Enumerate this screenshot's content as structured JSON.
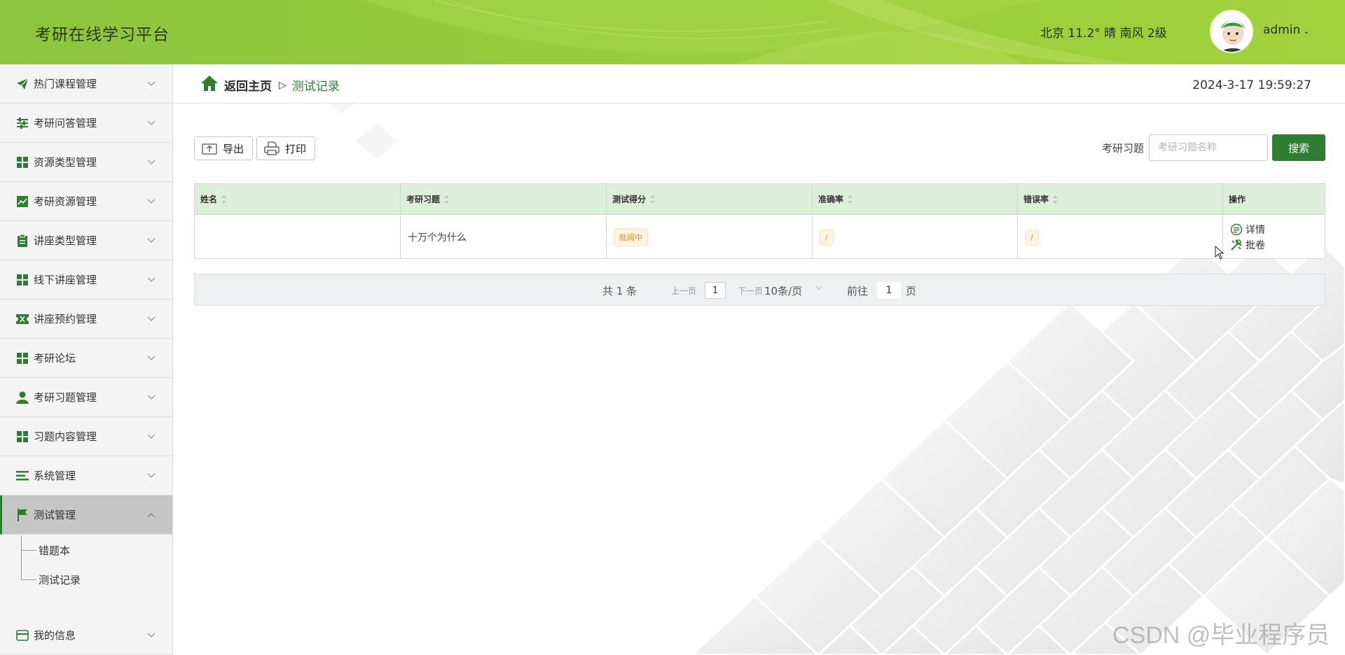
{
  "header": {
    "app_title": "考研在线学习平台",
    "weather": "北京  11.2°  晴  南风  2级",
    "username": "admin",
    "caret": "⌄"
  },
  "sidebar": {
    "items": [
      {
        "label": "热门课程管理",
        "icon": "paper-plane-icon"
      },
      {
        "label": "考研问答管理",
        "icon": "sliders-icon"
      },
      {
        "label": "资源类型管理",
        "icon": "grid-icon"
      },
      {
        "label": "考研资源管理",
        "icon": "chart-line-icon"
      },
      {
        "label": "讲座类型管理",
        "icon": "clipboard-icon"
      },
      {
        "label": "线下讲座管理",
        "icon": "grid-icon"
      },
      {
        "label": "讲座预约管理",
        "icon": "ticket-icon"
      },
      {
        "label": "考研论坛",
        "icon": "grid-icon"
      },
      {
        "label": "考研习题管理",
        "icon": "user-icon"
      },
      {
        "label": "习题内容管理",
        "icon": "grid-icon"
      },
      {
        "label": "系统管理",
        "icon": "list-icon"
      },
      {
        "label": "测试管理",
        "icon": "flag-icon",
        "expanded": true
      },
      {
        "label": "我的信息",
        "icon": "wallet-icon"
      }
    ],
    "submenu": [
      {
        "label": "错题本"
      },
      {
        "label": "测试记录"
      }
    ]
  },
  "breadcrumb": {
    "home": "返回主页",
    "separator": "▷",
    "current": "测试记录"
  },
  "clock": "2024-3-17 19:59:27",
  "toolbar": {
    "export_label": "导出",
    "print_label": "打印"
  },
  "search": {
    "label": "考研习题",
    "placeholder": "考研习题名称",
    "button": "搜索"
  },
  "table": {
    "columns": [
      "姓名",
      "考研习题",
      "测试得分",
      "准确率",
      "错误率",
      "操作"
    ],
    "rows": [
      {
        "name": "",
        "exercise": "十万个为什么",
        "score": "批阅中",
        "accuracy": "/",
        "error_rate": "/",
        "actions": [
          "详情",
          "批卷"
        ]
      }
    ]
  },
  "pager": {
    "total": "共 1 条",
    "prev": "上一页",
    "current_page": "1",
    "next": "下一页",
    "page_size": "10条/页",
    "goto": "前往",
    "goto_value": "1",
    "page_unit": "页"
  },
  "watermark": "CSDN @毕业程序员",
  "colors": {
    "header_green": "#96cc3e",
    "accent_green": "#2e7d32",
    "table_header_bg": "#dcefd8",
    "tag_orange": "#e28d22"
  }
}
